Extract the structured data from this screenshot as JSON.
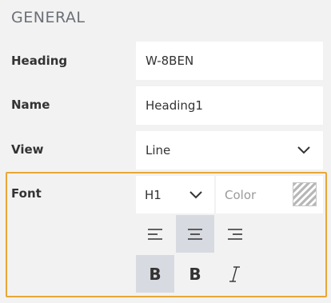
{
  "section": {
    "title": "GENERAL"
  },
  "heading": {
    "label": "Heading",
    "value": "W-8BEN"
  },
  "name": {
    "label": "Name",
    "value": "Heading1"
  },
  "view": {
    "label": "View",
    "value": "Line",
    "icon": "chevron-down-icon"
  },
  "font": {
    "label": "Font",
    "size_value": "H1",
    "size_icon": "chevron-down-icon",
    "color_placeholder": "Color",
    "color_swatch_icon": "transparent-swatch-icon",
    "align_buttons": [
      {
        "name": "align-left",
        "icon": "align-left-icon",
        "active": false
      },
      {
        "name": "align-center",
        "icon": "align-center-icon",
        "active": true
      },
      {
        "name": "align-right",
        "icon": "align-right-icon",
        "active": false
      }
    ],
    "style_buttons": [
      {
        "name": "bold-heavy",
        "glyph": "B",
        "active": true
      },
      {
        "name": "bold",
        "glyph": "B",
        "active": false
      },
      {
        "name": "italic",
        "glyph": "I",
        "active": false
      }
    ]
  },
  "colors": {
    "background": "#f2f2f2",
    "field": "#ffffff",
    "highlight_border": "#e8a735",
    "active_button": "#d7dae0"
  }
}
